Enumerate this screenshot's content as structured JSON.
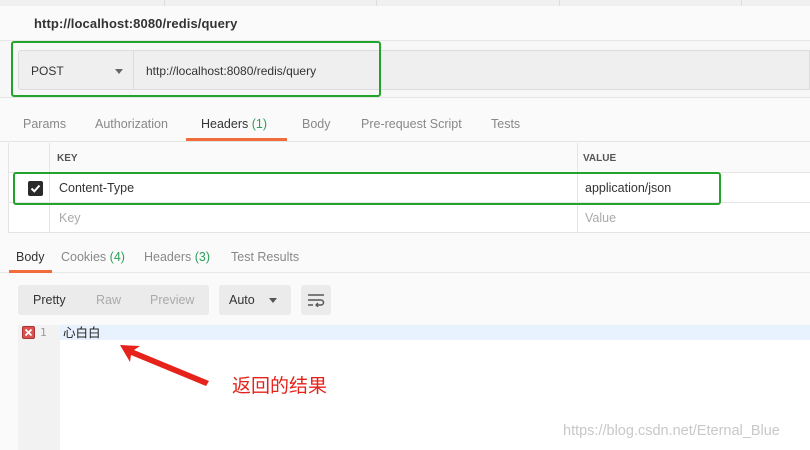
{
  "request": {
    "title": "http://localhost:8080/redis/query",
    "method": "POST",
    "url": "http://localhost:8080/redis/query"
  },
  "request_tabs": [
    {
      "label": "Params"
    },
    {
      "label": "Authorization"
    },
    {
      "label": "Headers",
      "count": "(1)"
    },
    {
      "label": "Body"
    },
    {
      "label": "Pre-request Script"
    },
    {
      "label": "Tests"
    }
  ],
  "headers_table": {
    "key_header": "KEY",
    "value_header": "VALUE",
    "rows": [
      {
        "key": "Content-Type",
        "value": "application/json",
        "checked": true
      }
    ],
    "key_placeholder": "Key",
    "value_placeholder": "Value"
  },
  "response_tabs": [
    {
      "label": "Body"
    },
    {
      "label": "Cookies",
      "count": "(4)"
    },
    {
      "label": "Headers",
      "count": "(3)"
    },
    {
      "label": "Test Results"
    }
  ],
  "format_buttons": [
    "Pretty",
    "Raw",
    "Preview"
  ],
  "language": "Auto",
  "response_body": {
    "line_number": "1",
    "content": "心白白"
  },
  "annotation": "返回的结果",
  "watermark": "https://blog.csdn.net/Eternal_Blue",
  "colors": {
    "highlight_box": "#22a32b",
    "active_tab_underline": "#f26b3a",
    "count_green": "#2e9e5b",
    "annotation_red": "#e5231b"
  }
}
